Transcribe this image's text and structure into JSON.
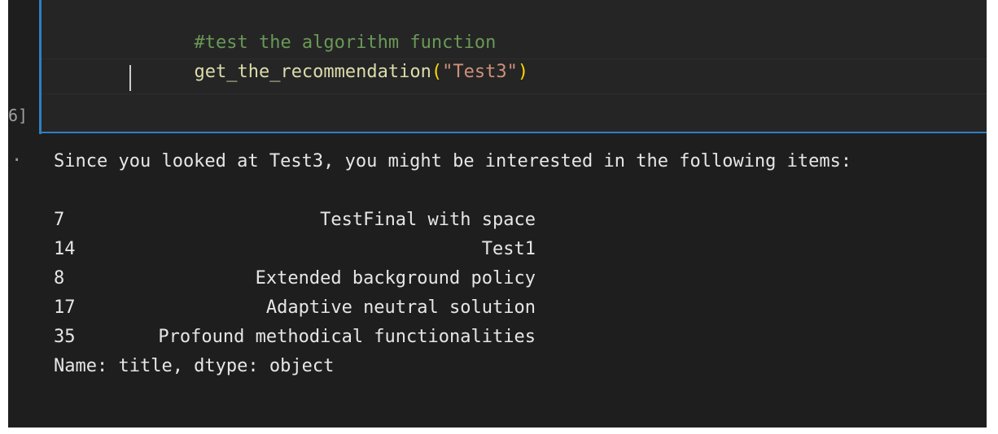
{
  "cell": {
    "execution_count": "6]",
    "code_lines": [
      {
        "comment": "#test the algorithm function"
      },
      {
        "func": "get_the_recommendation",
        "open_paren": "(",
        "arg": "\"Test3\"",
        "close_paren": ")"
      }
    ]
  },
  "output": {
    "marker": "·",
    "message": "Since you looked at Test3, you might be interested in the following items:",
    "rows": [
      {
        "index": "7",
        "title": "TestFinal with space"
      },
      {
        "index": "14",
        "title": "Test1"
      },
      {
        "index": "8",
        "title": "Extended background policy"
      },
      {
        "index": "17",
        "title": "Adaptive neutral solution"
      },
      {
        "index": "35",
        "title": "Profound methodical functionalities"
      }
    ],
    "footer": "Name: title, dtype: object"
  },
  "colors": {
    "editor_bg": "#1e1e1e",
    "cell_bg": "#252526",
    "cell_border": "#2f7fc1",
    "comment": "#6a9955",
    "function": "#dcdcaa",
    "paren": "#ffd700",
    "string": "#ce9178",
    "output_text": "#e6e6e6"
  }
}
